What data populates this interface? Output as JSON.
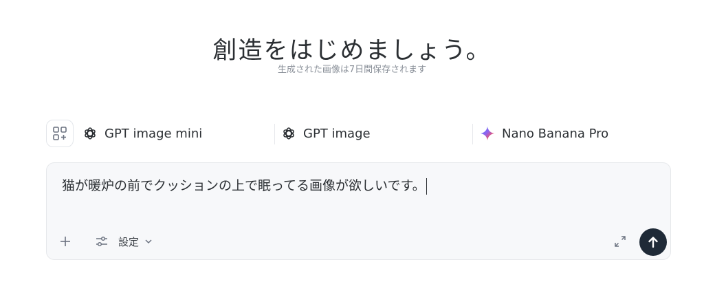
{
  "hero": {
    "title": "創造をはじめましょう。",
    "subtitle": "生成された画像は7日間保存されます"
  },
  "models": [
    {
      "label": "GPT image mini",
      "icon": "openai-icon"
    },
    {
      "label": "GPT image",
      "icon": "openai-icon"
    },
    {
      "label": "Nano Banana Pro",
      "icon": "gemini-sparkle-icon"
    }
  ],
  "composer": {
    "prompt_value": "猫が暖炉の前でクッションの上で眠ってる画像が欲しいです。",
    "settings_label": "設定"
  },
  "colors": {
    "send_button": "#1f2a37",
    "composer_bg": "#f7f8fa",
    "border": "#e6e8eb"
  }
}
